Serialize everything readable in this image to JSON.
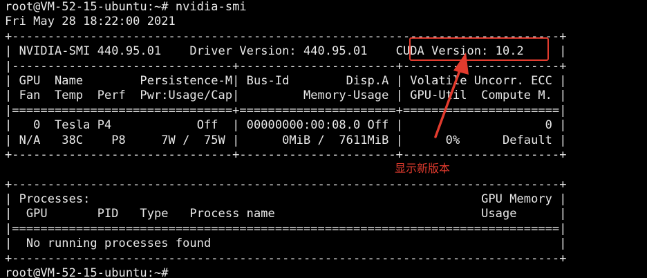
{
  "terminal": {
    "lines": [
      "root@VM-52-15-ubuntu:~# nvidia-smi",
      "Fri May 28 18:22:00 2021",
      "+-----------------------------------------------------------------------------+",
      "| NVIDIA-SMI 440.95.01    Driver Version: 440.95.01    CUDA Version: 10.2     |",
      "|-------------------------------+----------------------+----------------------+",
      "| GPU  Name        Persistence-M| Bus-Id        Disp.A | Volatile Uncorr. ECC |",
      "| Fan  Temp  Perf  Pwr:Usage/Cap|         Memory-Usage | GPU-Util  Compute M. |",
      "|===============================+======================+======================|",
      "|   0  Tesla P4            Off  | 00000000:00:08.0 Off |                    0 |",
      "| N/A   38C    P8     7W /  75W |      0MiB /  7611MiB |      0%      Default |",
      "+-------------------------------+----------------------+----------------------+",
      "",
      "+-----------------------------------------------------------------------------+",
      "| Processes:                                                       GPU Memory |",
      "|  GPU       PID   Type   Process name                             Usage      |",
      "|=============================================================================|",
      "|  No running processes found                                                 |",
      "+-----------------------------------------------------------------------------+",
      "root@VM-52-15-ubuntu:~#"
    ]
  },
  "annotation": {
    "label": "显示新版本",
    "color": "#e23b2e"
  }
}
